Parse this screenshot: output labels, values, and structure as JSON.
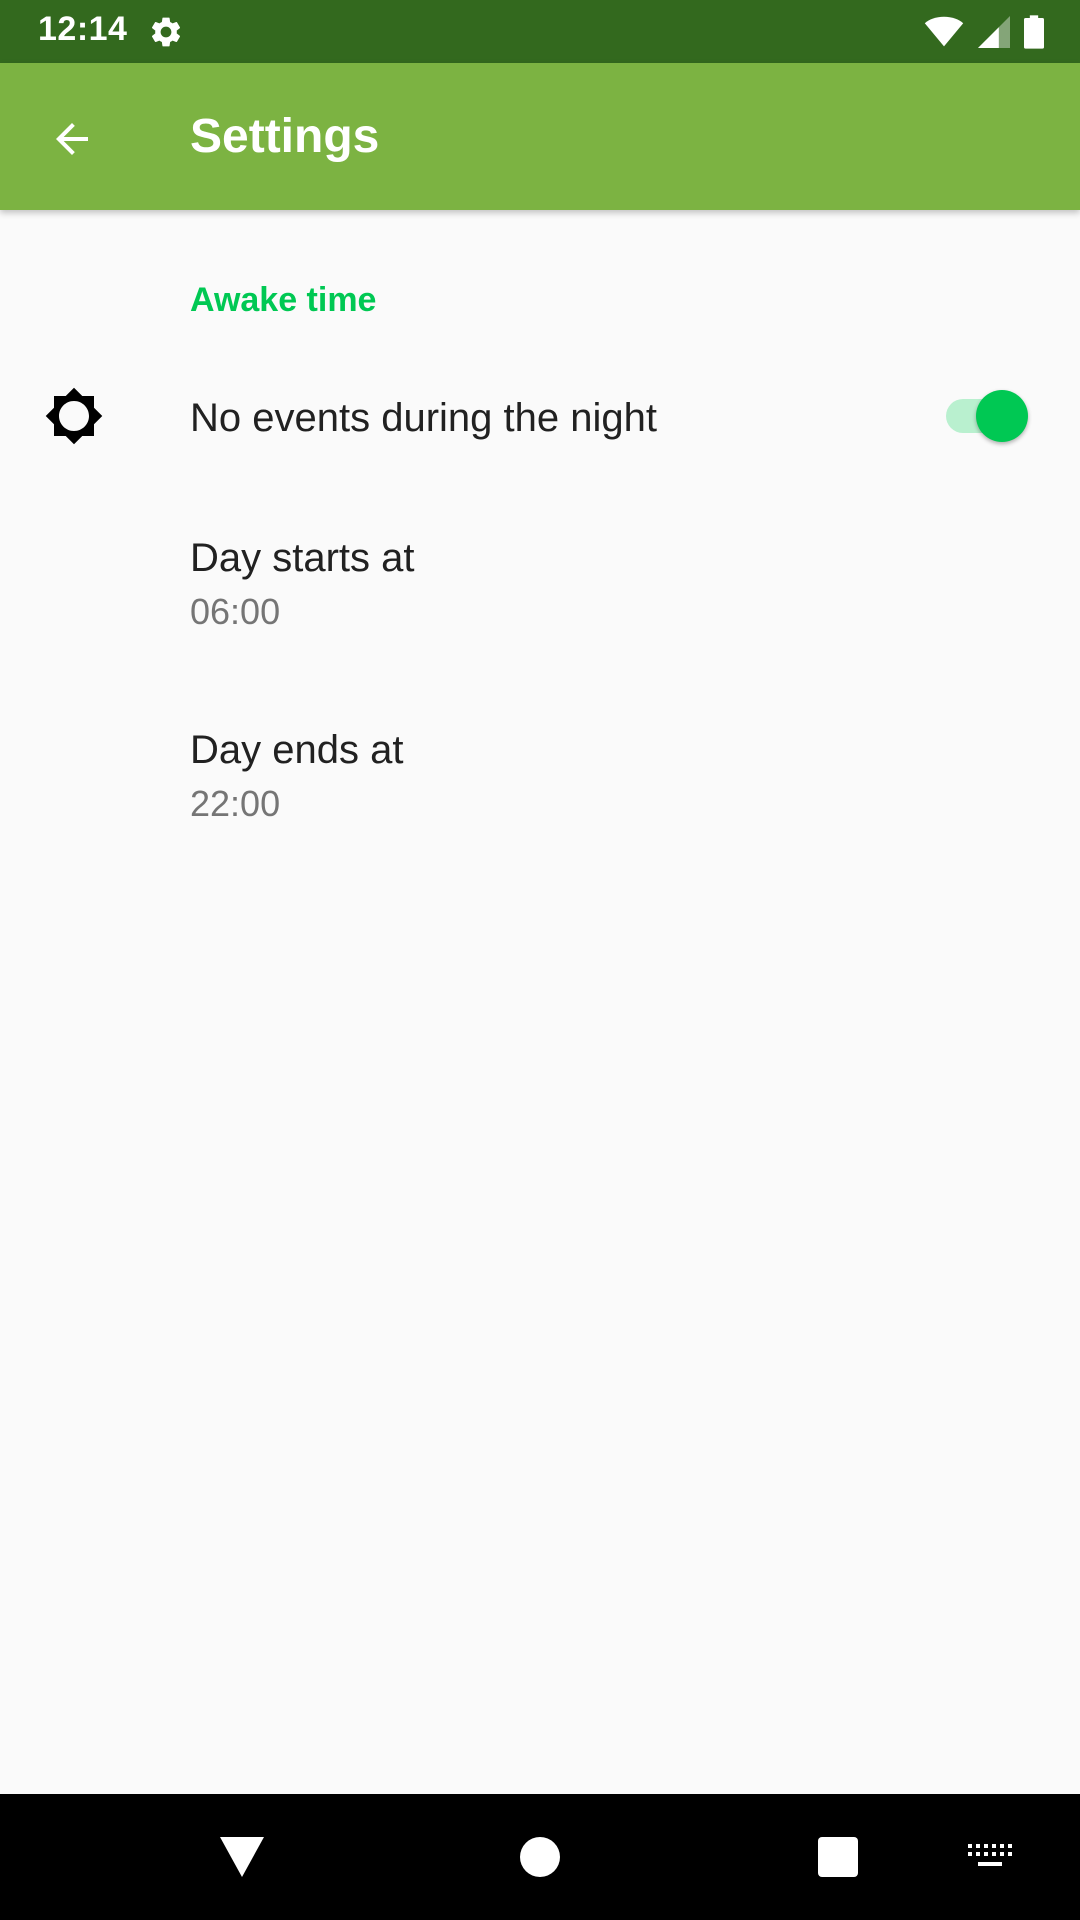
{
  "status_bar": {
    "time": "12:14",
    "icons": [
      "settings-gear-icon",
      "wifi-icon",
      "cellular-signal-icon",
      "battery-icon"
    ],
    "background": "#33691e"
  },
  "app_bar": {
    "title": "Settings",
    "back_icon": "arrow-back-icon",
    "background": "#7cb342"
  },
  "section": {
    "header": "Awake time",
    "accent_color": "#00c853"
  },
  "preferences": [
    {
      "icon": "brightness-icon",
      "title": "No events during the night",
      "switch_on": true
    },
    {
      "title": "Day starts at",
      "summary": "06:00"
    },
    {
      "title": "Day ends at",
      "summary": "22:00"
    }
  ],
  "nav_bar": {
    "buttons": [
      "back-triangle-icon",
      "home-circle-icon",
      "recents-square-icon",
      "keyboard-icon"
    ]
  }
}
